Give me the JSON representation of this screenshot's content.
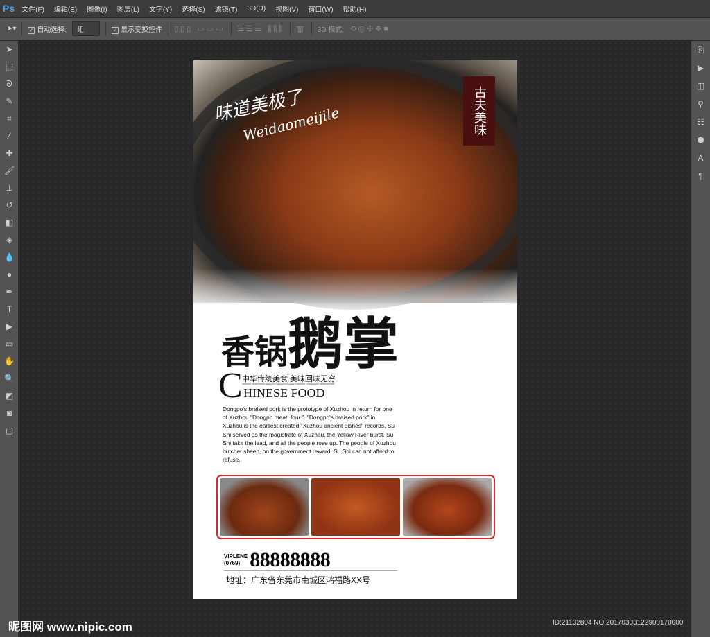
{
  "app": {
    "logo": "Ps",
    "menus": [
      "文件(F)",
      "编辑(E)",
      "图像(I)",
      "图层(L)",
      "文字(Y)",
      "选择(S)",
      "滤镜(T)",
      "3D(D)",
      "视图(V)",
      "窗口(W)",
      "帮助(H)"
    ]
  },
  "options": {
    "auto_select_label": "自动选择:",
    "auto_select_value": "组",
    "show_transform_label": "显示变换控件",
    "mode_3d_label": "3D 模式:"
  },
  "poster": {
    "tag": "古夫美味",
    "script_cn": "味道美极了",
    "script_en": "Weidaomeijile",
    "title_small1": "香",
    "title_small2": "锅",
    "title_big1": "鹅",
    "title_big2": "掌",
    "subtitle_cn": "中华传统美食  美味回味无穷",
    "subtitle_tiny": "CHINESE TRADITIONAL DELICACY DELICIOUS LEAD A PERSON TO ENDLESS AFTERTASTES",
    "big_c": "C",
    "chinese_food": "HINESE FOOD",
    "body": "Dongpo's braised pork is the prototype of Xuzhou in return for one of Xuzhou \"Dongpo meat, four.\". \"Dongpo's braised pork\" in Xuzhou is the earliest created \"Xuzhou ancient dishes\" records, Su Shi served as the magistrate of Xuzhou, the Yellow River burst, Su Shi take the lead, and all the people rose up. The people of Xuzhou butcher sheep, on the government reward, Su Shi can not afford to refuse,",
    "viplene": "VIPLENE",
    "area_code": "(0769)",
    "phone": "88888888",
    "address": "地址：广东省东莞市南城区鸿福路XX号"
  },
  "watermark": {
    "site": "昵图网 www.nipic.com",
    "id": "ID:21132804 NO:20170303122900170000"
  }
}
